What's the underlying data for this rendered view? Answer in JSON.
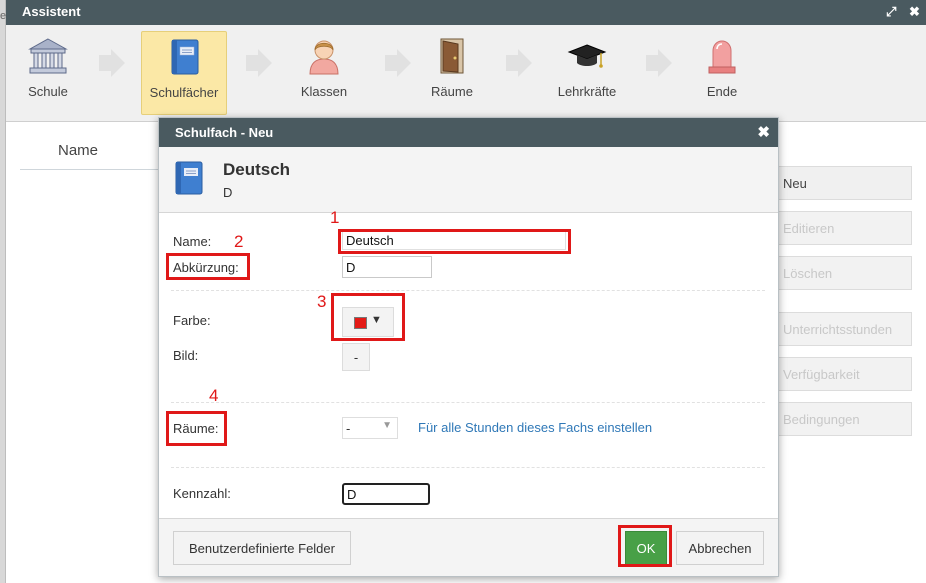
{
  "window": {
    "title": "Assistent",
    "left_edge_char": "e",
    "expand_icon": "⤢",
    "close_icon": "✖"
  },
  "steps": [
    {
      "label": "Schule",
      "icon": "building-icon"
    },
    {
      "label": "Schulfächer",
      "icon": "book-icon",
      "active": true
    },
    {
      "label": "Klassen",
      "icon": "person-icon"
    },
    {
      "label": "Räume",
      "icon": "door-icon"
    },
    {
      "label": "Lehrkräfte",
      "icon": "graduation-cap-icon"
    },
    {
      "label": "Ende",
      "icon": "alarm-light-icon"
    }
  ],
  "background": {
    "name_column": "Name",
    "buttons": [
      {
        "label": "Neu",
        "enabled": true
      },
      {
        "label": "Editieren",
        "enabled": false
      },
      {
        "label": "Löschen",
        "enabled": false
      },
      {
        "label": "Unterrichtsstunden",
        "enabled": false
      },
      {
        "label": "Verfügbarkeit",
        "enabled": false
      },
      {
        "label": "Bedingungen",
        "enabled": false
      }
    ]
  },
  "dialog": {
    "title": "Schulfach - Neu",
    "close": "✖",
    "heading": "Deutsch",
    "subheading": "D",
    "fields": {
      "name_label": "Name:",
      "name_value": "Deutsch",
      "abbr_label": "Abkürzung:",
      "abbr_value": "D",
      "color_label": "Farbe:",
      "color_value": "#e41b17",
      "color_dropdown": "▼",
      "image_label": "Bild:",
      "image_value": "-",
      "rooms_label": "Räume:",
      "rooms_value": "-",
      "rooms_link": "Für alle Stunden dieses Fachs einstellen",
      "code_label": "Kennzahl:",
      "code_value": "D"
    },
    "footer": {
      "custom_fields": "Benutzerdefinierte Felder",
      "ok": "OK",
      "cancel": "Abbrechen"
    }
  },
  "annotations": {
    "n1": "1",
    "n2": "2",
    "n3": "3",
    "n4": "4",
    "color": "#e01818"
  }
}
